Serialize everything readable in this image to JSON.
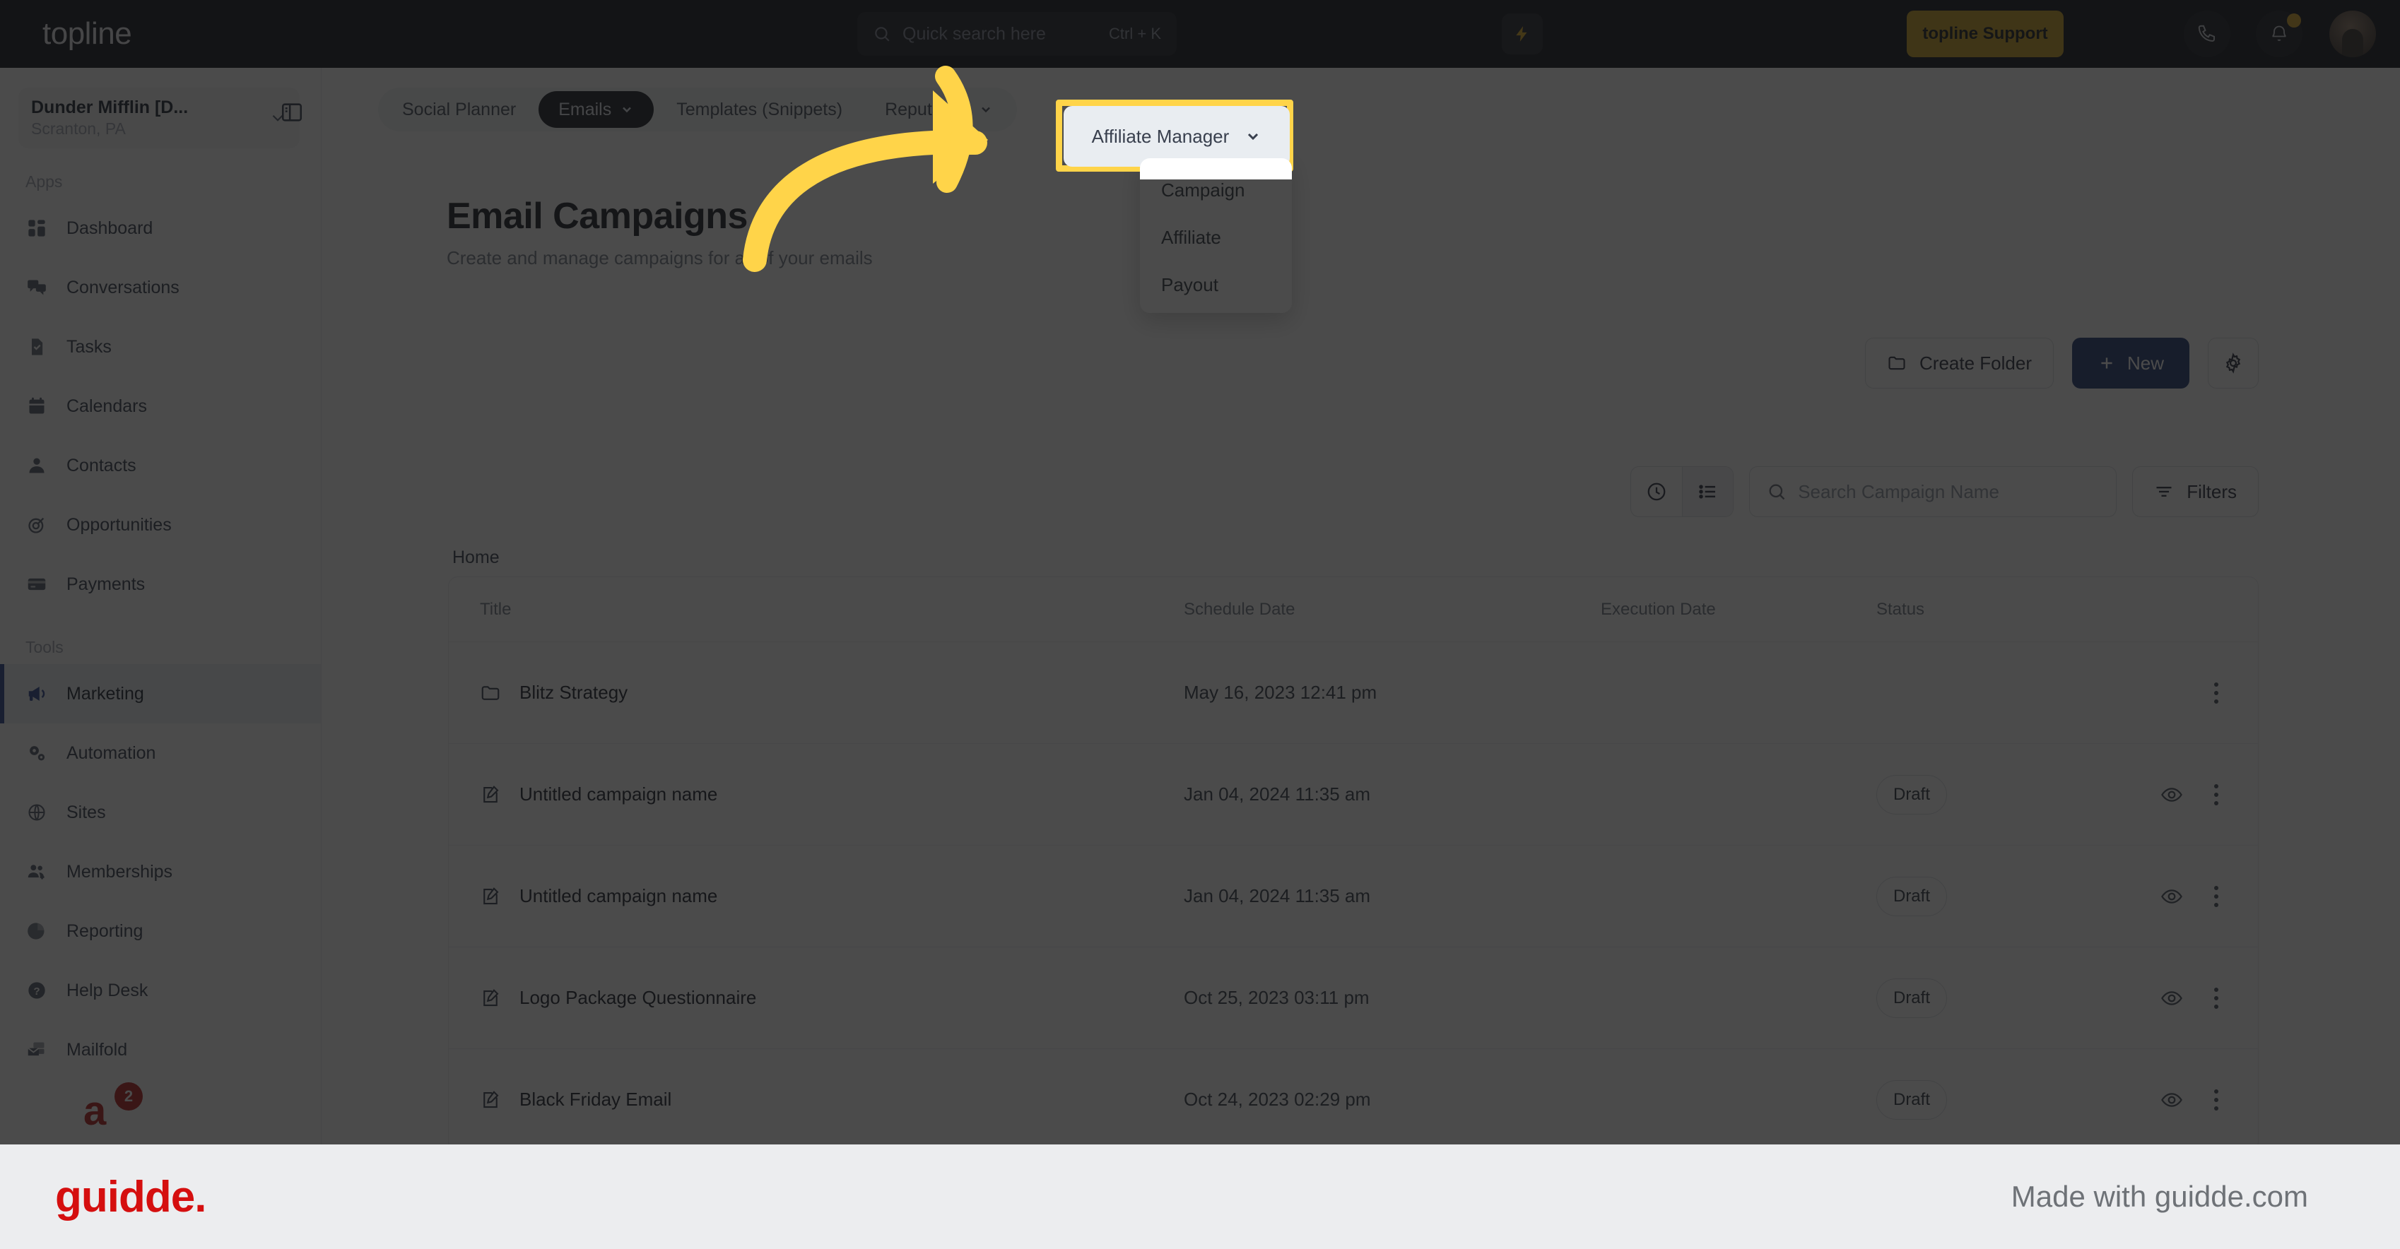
{
  "topbar": {
    "logo": "topline",
    "search": {
      "placeholder": "Quick search here",
      "shortcut": "Ctrl + K",
      "icon": "search-icon"
    },
    "bolt_icon": "lightning-bolt-icon",
    "support_label": "topline Support",
    "phone_icon": "phone-icon",
    "bell_icon": "bell-icon",
    "avatar": "user-avatar"
  },
  "sidebar": {
    "org_name": "Dunder Mifflin [D...",
    "org_location": "Scranton, PA",
    "panel_toggle_icon": "panel-collapse-icon",
    "sections": [
      {
        "label": "Apps",
        "items": [
          {
            "label": "Dashboard",
            "icon": "dashboard-icon",
            "active": false
          },
          {
            "label": "Conversations",
            "icon": "chat-bubbles-icon",
            "active": false
          },
          {
            "label": "Tasks",
            "icon": "task-check-icon",
            "active": false
          },
          {
            "label": "Calendars",
            "icon": "calendar-icon",
            "active": false
          },
          {
            "label": "Contacts",
            "icon": "person-icon",
            "active": false
          },
          {
            "label": "Opportunities",
            "icon": "target-icon",
            "active": false
          },
          {
            "label": "Payments",
            "icon": "credit-card-icon",
            "active": false
          }
        ]
      },
      {
        "label": "Tools",
        "items": [
          {
            "label": "Marketing",
            "icon": "megaphone-icon",
            "active": true
          },
          {
            "label": "Automation",
            "icon": "gears-icon",
            "active": false
          },
          {
            "label": "Sites",
            "icon": "globe-icon",
            "active": false
          },
          {
            "label": "Memberships",
            "icon": "people-plus-icon",
            "active": false
          },
          {
            "label": "Reporting",
            "icon": "pie-chart-icon",
            "active": false
          },
          {
            "label": "Help Desk",
            "icon": "question-circle-icon",
            "active": false
          },
          {
            "label": "Mailfold",
            "icon": "mail-stack-icon",
            "active": false
          }
        ]
      }
    ],
    "badge_count": "2"
  },
  "subnav": {
    "tabs": [
      {
        "label": "Social Planner",
        "selected": false,
        "caret": false
      },
      {
        "label": "Emails",
        "selected": true,
        "caret": true
      },
      {
        "label": "Templates (Snippets)",
        "selected": false,
        "caret": false
      },
      {
        "label": "Reputation",
        "selected": false,
        "caret": true
      }
    ],
    "affiliate_dropdown": {
      "value": "Affiliate Manager",
      "caret_icon": "chevron-down-icon",
      "options": [
        "Campaign",
        "Affiliate",
        "Payout"
      ]
    }
  },
  "main": {
    "title": "Email Campaigns",
    "subtitle": "Create and manage campaigns for all of your emails",
    "actions": {
      "create_folder": "Create Folder",
      "create_folder_icon": "folder-icon",
      "new": "New",
      "new_icon": "plus-icon",
      "settings_icon": "gear-icon"
    },
    "tools": {
      "history_icon": "clock-icon",
      "list_icon": "list-view-icon",
      "search_placeholder": "Search Campaign Name",
      "search_icon": "search-icon",
      "filters_label": "Filters",
      "filters_icon": "filter-icon"
    },
    "breadcrumb": "Home",
    "table": {
      "columns": [
        "Title",
        "Schedule Date",
        "Execution Date",
        "Status"
      ],
      "rows": [
        {
          "icon": "folder-icon",
          "title": "Blitz Strategy",
          "schedule": "May 16, 2023 12:41 pm",
          "execution": "",
          "status": "",
          "has_eye": false
        },
        {
          "icon": "edit-doc-icon",
          "title": "Untitled campaign name",
          "schedule": "Jan 04, 2024 11:35 am",
          "execution": "",
          "status": "Draft",
          "has_eye": true
        },
        {
          "icon": "edit-doc-icon",
          "title": "Untitled campaign name",
          "schedule": "Jan 04, 2024 11:35 am",
          "execution": "",
          "status": "Draft",
          "has_eye": true
        },
        {
          "icon": "edit-doc-icon",
          "title": "Logo Package Questionnaire",
          "schedule": "Oct 25, 2023 03:11 pm",
          "execution": "",
          "status": "Draft",
          "has_eye": true
        },
        {
          "icon": "edit-doc-icon",
          "title": "Black Friday Email",
          "schedule": "Oct 24, 2023 02:29 pm",
          "execution": "",
          "status": "Draft",
          "has_eye": true
        }
      ]
    }
  },
  "footer": {
    "logo": "guidde.",
    "made_with": "Made with guidde.com"
  },
  "colors": {
    "highlight": "#ffd449",
    "primary": "#15306f",
    "brand_support": "#c99a15",
    "guidde_red": "#d50f0f"
  }
}
